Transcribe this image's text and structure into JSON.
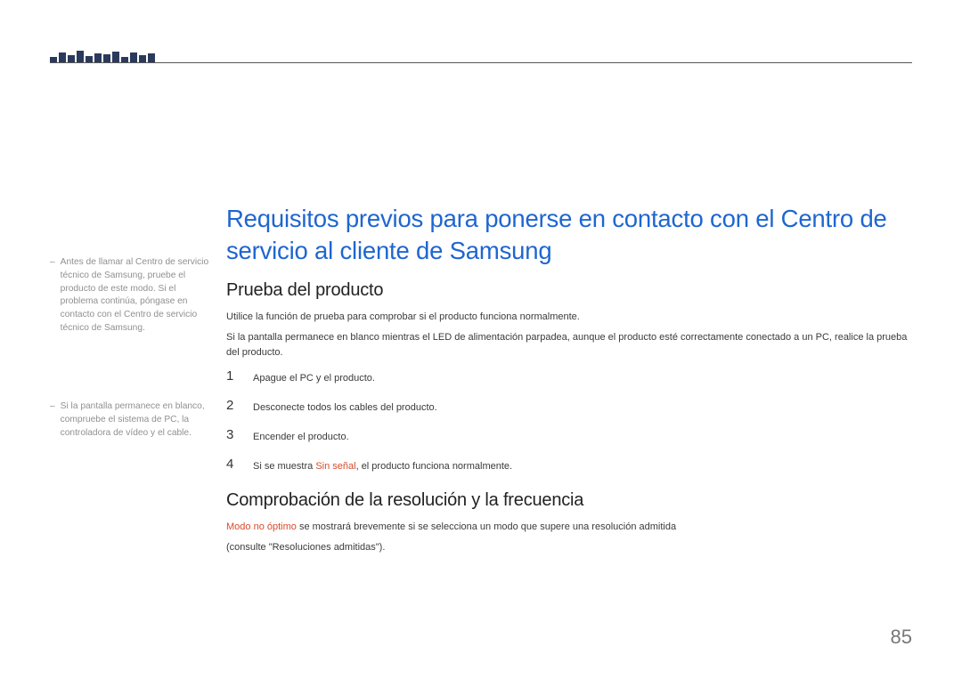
{
  "title": "Requisitos previos para ponerse en contacto con el Centro de servicio al cliente de Samsung",
  "sections": {
    "test": {
      "heading": "Prueba del producto",
      "p1": "Utilice la función de prueba para comprobar si el producto funciona normalmente.",
      "p2": "Si la pantalla permanece en blanco mientras el LED de alimentación parpadea, aunque el producto esté correctamente conectado a un PC, realice la prueba del producto.",
      "steps": [
        {
          "n": "1",
          "text": "Apague el PC y el producto."
        },
        {
          "n": "2",
          "text": "Desconecte todos los cables del producto."
        },
        {
          "n": "3",
          "text": "Encender el producto."
        },
        {
          "n": "4",
          "prefix": "Si se muestra ",
          "red": "Sin señal",
          "suffix": ", el producto funciona normalmente."
        }
      ]
    },
    "res": {
      "heading": "Comprobación de la resolución y la frecuencia",
      "red": "Modo no óptimo",
      "p1_suffix": " se mostrará brevemente si se selecciona un modo que supere una resolución admitida",
      "p2": "(consulte \"Resoluciones admitidas\")."
    }
  },
  "sidenotes": {
    "n1": "Antes de llamar al Centro de servicio técnico de Samsung, pruebe el producto de este modo. Si el problema continúa, póngase en contacto con el Centro de servicio técnico de Samsung.",
    "n2": "Si la pantalla permanece en blanco, compruebe el sistema de PC, la controladora de vídeo y el cable."
  },
  "page_number": "85"
}
